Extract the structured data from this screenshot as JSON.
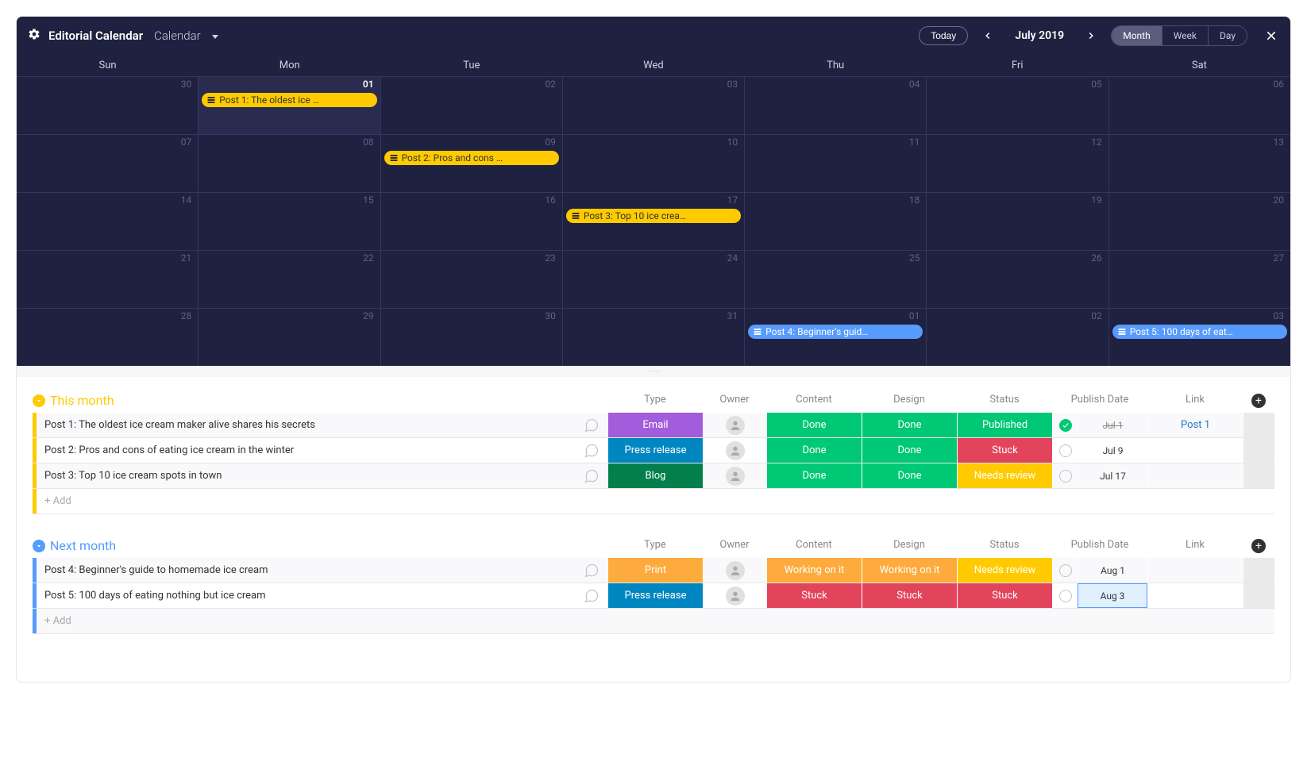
{
  "header": {
    "title": "Editorial Calendar",
    "viewLabel": "Calendar",
    "today": "Today",
    "monthLabel": "July 2019",
    "views": {
      "month": "Month",
      "week": "Week",
      "day": "Day"
    }
  },
  "days": [
    "Sun",
    "Mon",
    "Tue",
    "Wed",
    "Thu",
    "Fri",
    "Sat"
  ],
  "weeks": [
    {
      "nums": [
        "30",
        "01",
        "02",
        "03",
        "04",
        "05",
        "06"
      ],
      "hilite": 1,
      "curIdx": 1,
      "events": [
        {
          "col": 1,
          "color": "yellow",
          "label": "Post 1: The oldest ice …"
        }
      ]
    },
    {
      "nums": [
        "07",
        "08",
        "09",
        "10",
        "11",
        "12",
        "13"
      ],
      "events": [
        {
          "col": 2,
          "color": "yellow",
          "label": "Post 2: Pros and cons …"
        }
      ]
    },
    {
      "nums": [
        "14",
        "15",
        "16",
        "17",
        "18",
        "19",
        "20"
      ],
      "events": [
        {
          "col": 3,
          "color": "yellow",
          "label": "Post 3: Top 10 ice crea…"
        }
      ]
    },
    {
      "nums": [
        "21",
        "22",
        "23",
        "24",
        "25",
        "26",
        "27"
      ],
      "events": []
    },
    {
      "nums": [
        "28",
        "29",
        "30",
        "31",
        "01",
        "02",
        "03"
      ],
      "events": [
        {
          "col": 4,
          "color": "blue",
          "label": "Post 4: Beginner's guid…"
        },
        {
          "col": 6,
          "color": "blue",
          "label": "Post 5: 100 days of eat…"
        }
      ]
    }
  ],
  "columns": {
    "type": "Type",
    "owner": "Owner",
    "content": "Content",
    "design": "Design",
    "status": "Status",
    "publishDate": "Publish Date",
    "link": "Link"
  },
  "addRow": "+ Add",
  "groups": [
    {
      "title": "This month",
      "color": "yellow",
      "rows": [
        {
          "title": "Post 1: The oldest ice cream maker alive shares his secrets",
          "type": "Email",
          "typeColor": "c-purple",
          "content": "Done",
          "contentColor": "c-green",
          "design": "Done",
          "designColor": "c-green",
          "status": "Published",
          "statusColor": "c-green",
          "checked": true,
          "date": "Jul 1",
          "dateStruck": true,
          "link": "Post 1"
        },
        {
          "title": "Post 2: Pros and cons of eating ice cream in the winter",
          "type": "Press release",
          "typeColor": "c-blue2",
          "content": "Done",
          "contentColor": "c-green",
          "design": "Done",
          "designColor": "c-green",
          "status": "Stuck",
          "statusColor": "c-red",
          "checked": false,
          "date": "Jul 9"
        },
        {
          "title": "Post 3: Top 10 ice cream spots in town",
          "type": "Blog",
          "typeColor": "c-dgreen",
          "content": "Done",
          "contentColor": "c-green",
          "design": "Done",
          "designColor": "c-green",
          "status": "Needs review",
          "statusColor": "c-yellow2",
          "checked": false,
          "date": "Jul 17"
        }
      ]
    },
    {
      "title": "Next month",
      "color": "blue",
      "rows": [
        {
          "title": "Post 4: Beginner's guide to homemade ice cream",
          "type": "Print",
          "typeColor": "c-orange",
          "content": "Working on it",
          "contentColor": "c-orange",
          "design": "Working on it",
          "designColor": "c-orange",
          "status": "Needs review",
          "statusColor": "c-yellow2",
          "checked": false,
          "date": "Aug 1"
        },
        {
          "title": "Post 5: 100 days of eating nothing but ice cream",
          "type": "Press release",
          "typeColor": "c-blue2",
          "content": "Stuck",
          "contentColor": "c-red",
          "design": "Stuck",
          "designColor": "c-red",
          "status": "Stuck",
          "statusColor": "c-red",
          "checked": false,
          "date": "Aug 3",
          "dateHighlight": true
        }
      ]
    }
  ]
}
